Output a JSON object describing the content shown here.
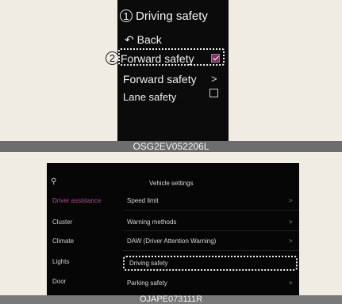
{
  "panel1": {
    "title": "Driving safety",
    "title_marker": "1",
    "back": "Back",
    "items": [
      {
        "label": "Forward safety",
        "state": "checked"
      },
      {
        "label": "Forward safety",
        "state": "submenu"
      },
      {
        "label": "Lane safety",
        "state": "unchecked"
      }
    ],
    "item_marker": "2",
    "caption": "OSG2EV052206L",
    "accent": "#8a2d6a"
  },
  "panel2": {
    "header": "Vehicle settings",
    "sidebar": [
      "Driver assistance",
      "Cluster",
      "Climate",
      "Lights",
      "Door"
    ],
    "sidebar_active": "Driver assistance",
    "menu": [
      "Speed limit",
      "Warning methods",
      "DAW (Driver Attention Warning)",
      "Driving safety",
      "Parking safety"
    ],
    "caption": "OJAPE073111R",
    "accent": "#b04c95"
  }
}
